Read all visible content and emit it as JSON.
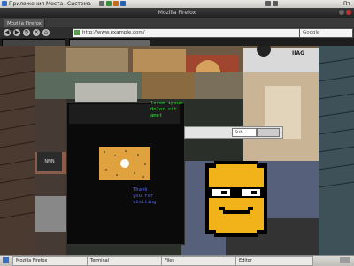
{
  "topbar": {
    "menus": [
      "Приложения",
      "Места",
      "Система"
    ],
    "clock": "Пт"
  },
  "window": {
    "title": "Mozilla Firefox",
    "tab_label": "Mozilla Firefox"
  },
  "nav": {
    "url": "http://www.example.com/",
    "search_placeholder": "Google"
  },
  "popup": {
    "field_value": "Sub...",
    "green_lines": [
      "lorem ipsum",
      "dolor sit",
      "amet"
    ],
    "blue_lines": [
      "Thank",
      "you for",
      "visiting"
    ]
  },
  "page": {
    "sign_text": "IIAG",
    "left_label": "NNN"
  },
  "taskbar": {
    "items": [
      "Mozilla Firefox",
      "Terminal",
      "Files",
      "Editor"
    ]
  },
  "colors": {
    "green_text": "#26e12a",
    "blue_text": "#5b67ff",
    "smiley": "#f2b21a"
  }
}
